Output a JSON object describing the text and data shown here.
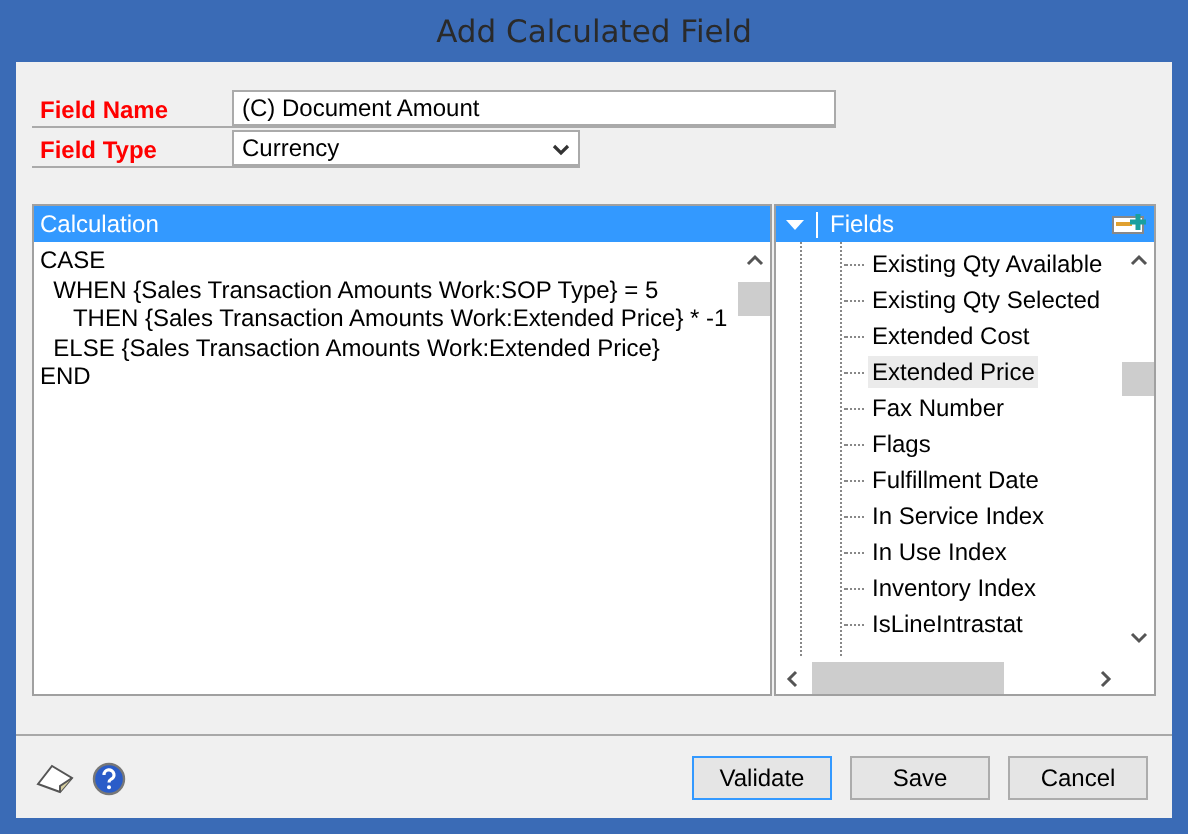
{
  "window": {
    "title": "Add Calculated Field"
  },
  "form": [
    {
      "label": "Field Name",
      "kind": "text",
      "value": "(C) Document Amount"
    },
    {
      "label": "Field Type",
      "kind": "dropdown",
      "value": "Currency"
    }
  ],
  "calculation": {
    "title": "Calculation",
    "text": "CASE\n  WHEN {Sales Transaction Amounts Work:SOP Type} = 5\n     THEN {Sales Transaction Amounts Work:Extended Price} * -1\n  ELSE {Sales Transaction Amounts Work:Extended Price}\nEND"
  },
  "fields": {
    "title": "Fields",
    "items": [
      {
        "label": "Existing Qty Available",
        "selected": false
      },
      {
        "label": "Existing Qty Selected",
        "selected": false
      },
      {
        "label": "Extended Cost",
        "selected": false
      },
      {
        "label": "Extended Price",
        "selected": true
      },
      {
        "label": "Fax Number",
        "selected": false
      },
      {
        "label": "Flags",
        "selected": false
      },
      {
        "label": "Fulfillment Date",
        "selected": false
      },
      {
        "label": "In Service Index",
        "selected": false
      },
      {
        "label": "In Use Index",
        "selected": false
      },
      {
        "label": "Inventory Index",
        "selected": false
      },
      {
        "label": "IsLineIntrastat",
        "selected": false
      }
    ]
  },
  "buttons": [
    {
      "label": "Validate",
      "default": true
    },
    {
      "label": "Save",
      "default": false
    },
    {
      "label": "Cancel",
      "default": false
    }
  ]
}
